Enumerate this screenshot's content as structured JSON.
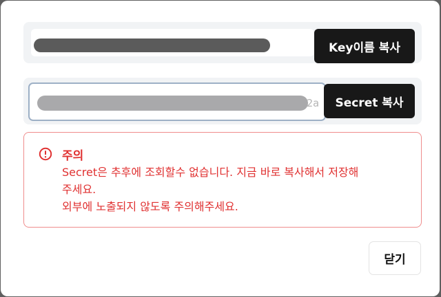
{
  "key_row": {
    "copy_label": "Key이름 복사"
  },
  "secret_row": {
    "visible_tail": "2a",
    "copy_label": "Secret 복사"
  },
  "warning": {
    "title": "주의",
    "line1": "Secret은 추후에 조회할수 없습니다. 지금 바로 복사해서 저장해",
    "line2": "주세요.",
    "line3": "외부에 노출되지 않도록 주의해주세요.",
    "icon": "alert-circle-icon",
    "color": "#e03131"
  },
  "footer": {
    "close_label": "닫기"
  }
}
